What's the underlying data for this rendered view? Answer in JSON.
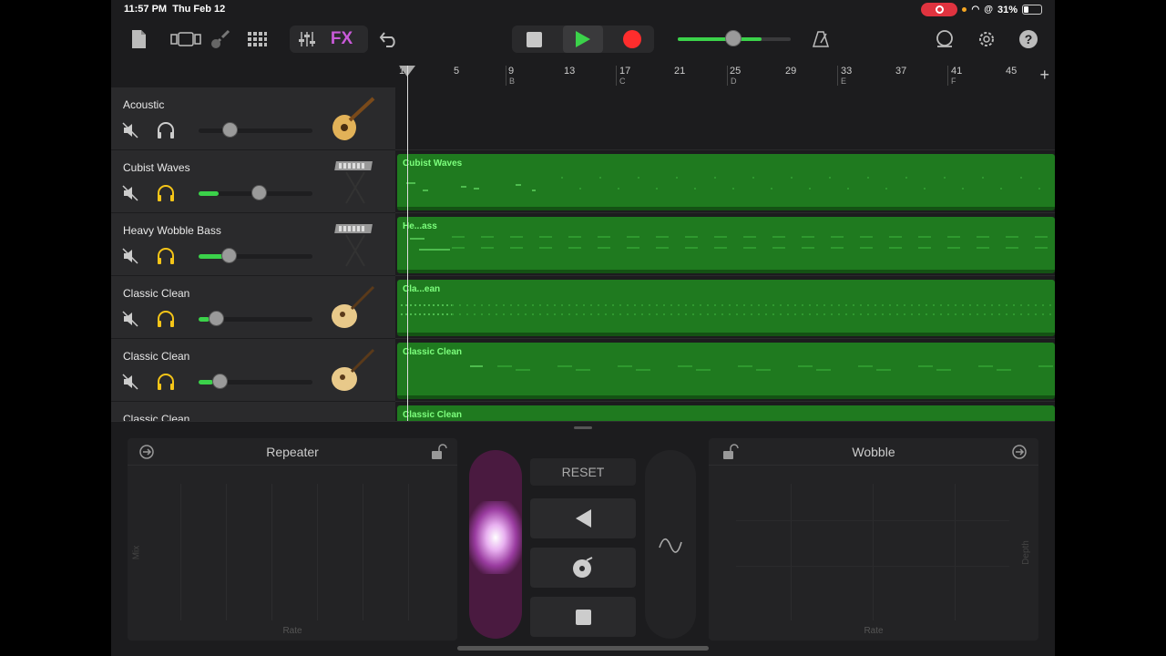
{
  "status": {
    "time": "11:57 PM",
    "date": "Thu Feb 12",
    "battery": "31%"
  },
  "toolbar": {
    "fx_label": "FX"
  },
  "ruler": {
    "bars": [
      "1",
      "5",
      "9",
      "13",
      "17",
      "21",
      "25",
      "29",
      "33",
      "37",
      "41",
      "45"
    ],
    "sections": [
      "B",
      "C",
      "D",
      "E",
      "F"
    ]
  },
  "tracks": [
    {
      "name": "Acoustic",
      "instrument": "acoustic-guitar-icon",
      "solo": false,
      "volume": 0.28,
      "region": ""
    },
    {
      "name": "Cubist Waves",
      "instrument": "keyboard-icon",
      "solo": true,
      "volume": 0.55,
      "region": "Cubist Waves"
    },
    {
      "name": "Heavy Wobble Bass",
      "instrument": "keyboard-icon",
      "solo": true,
      "volume": 0.27,
      "region": "He...ass"
    },
    {
      "name": "Classic Clean",
      "instrument": "electric-guitar-icon",
      "solo": true,
      "volume": 0.15,
      "region": "Cla...ean"
    },
    {
      "name": "Classic Clean",
      "instrument": "electric-guitar-icon",
      "solo": true,
      "volume": 0.18,
      "region": "Classic Clean"
    },
    {
      "name": "Classic Clean",
      "instrument": "electric-guitar-icon",
      "solo": false,
      "volume": 0.2,
      "region": "Classic Clean"
    }
  ],
  "fx": {
    "left_pad": {
      "title": "Repeater",
      "x_axis": "Rate",
      "y_axis": "Mix"
    },
    "right_pad": {
      "title": "Wobble",
      "x_axis": "Rate",
      "y_axis": "Depth"
    },
    "reset_label": "RESET"
  },
  "colors": {
    "region": "#1f7a1f",
    "accent_green": "#3bd24a",
    "fx": "#c85ad8",
    "record": "#ff2d2d"
  }
}
